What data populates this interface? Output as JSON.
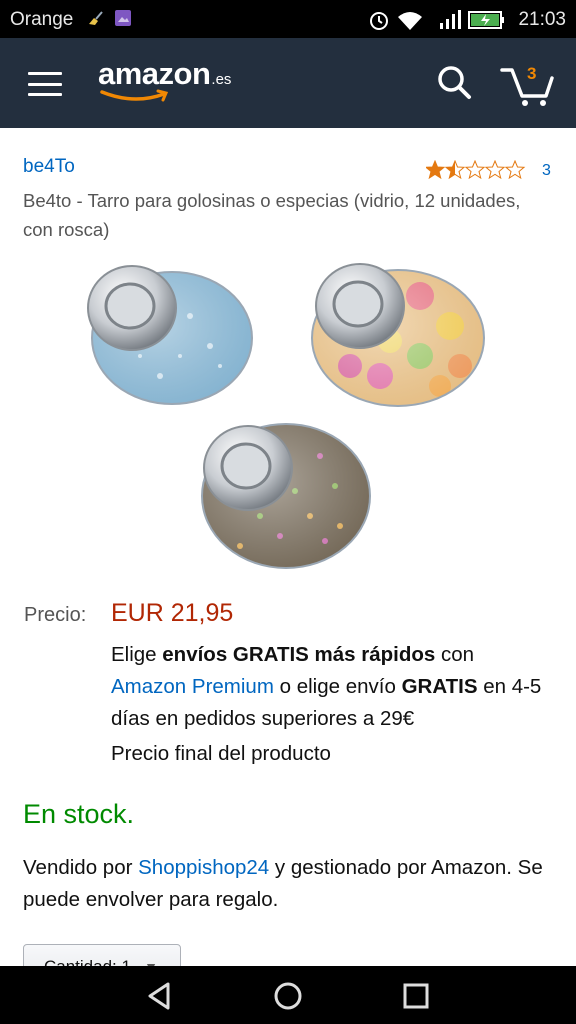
{
  "status_bar": {
    "carrier": "Orange",
    "time": "21:03",
    "icons": [
      "broom-icon",
      "gallery-icon",
      "alarm-icon",
      "wifi-icon",
      "signal-icon",
      "battery-charging-icon"
    ]
  },
  "header": {
    "logo_text": "amazon",
    "logo_tld": ".es",
    "cart_count": "3",
    "colors": {
      "background": "#232f3e",
      "accent": "#f08804"
    }
  },
  "product": {
    "brand": "be4To",
    "rating_stars": 1.5,
    "rating_max": 5,
    "review_count": "3",
    "title": "Be4to - Tarro para golosinas o especias (vidrio, 12 unidades, con rosca)",
    "price_label": "Precio:",
    "price": "EUR 21,95",
    "shipping": {
      "part1": "Elige ",
      "bold1": "envíos GRATIS más rápidos",
      "part2": " con ",
      "premium_link": "Amazon Premium",
      "part3": " o elige envío ",
      "bold2": "GRATIS",
      "part4": " en 4-5 días en pedidos superiores a 29€"
    },
    "final_price_note": "Precio final del producto",
    "stock": "En stock.",
    "seller": {
      "part1": "Vendido por ",
      "seller_link": "Shoppishop24",
      "part2": " y gestionado por Amazon. Se puede envolver para regalo."
    },
    "quantity": {
      "label": "Cantidad:",
      "value": "1"
    }
  },
  "colors": {
    "link": "#0066c0",
    "price": "#b12704",
    "stock": "#008a00",
    "star": "#e47911"
  }
}
